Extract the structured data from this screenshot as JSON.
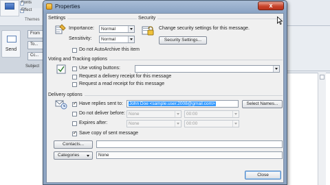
{
  "background": {
    "themes_label": "Themes",
    "fonts_label": "Fonts",
    "effects_label": "Effect",
    "send_label": "Send",
    "from_label": "From",
    "to_label": "To...",
    "cc_label": "Cc...",
    "subject_label": "Subject"
  },
  "dialog": {
    "title": "Properties",
    "close_glyph": "x",
    "settings": {
      "group_label": "Settings",
      "importance_label": "Importance:",
      "importance_value": "Normal",
      "sensitivity_label": "Sensitivity:",
      "sensitivity_value": "Normal",
      "no_autoarchive_label": "Do not AutoArchive this item"
    },
    "security": {
      "group_label": "Security",
      "description": "Change security settings for this message.",
      "button_label": "Security Settings..."
    },
    "voting": {
      "group_label": "Voting and Tracking options",
      "use_voting_label": "Use voting buttons:",
      "delivery_receipt_label": "Request a delivery receipt for this message",
      "read_receipt_label": "Request a read receipt for this message"
    },
    "delivery": {
      "group_label": "Delivery options",
      "replies_label": "Have replies sent to:",
      "replies_value": "John Doe <sample.user.2008@gmail.com>",
      "select_names_label": "Select Names...",
      "no_deliver_label": "Do not deliver before:",
      "no_deliver_date": "None",
      "no_deliver_time": "00:00",
      "expires_label": "Expires after:",
      "expires_date": "None",
      "expires_time": "00:00",
      "save_copy_label": "Save copy of sent message"
    },
    "contacts_button": "Contacts...",
    "categories_button": "Categories",
    "categories_value": "None",
    "close_button": "Close"
  },
  "colors": {
    "titlebar": "#8aa3c3",
    "close_button": "#c8442b",
    "selection": "#3399ff"
  }
}
